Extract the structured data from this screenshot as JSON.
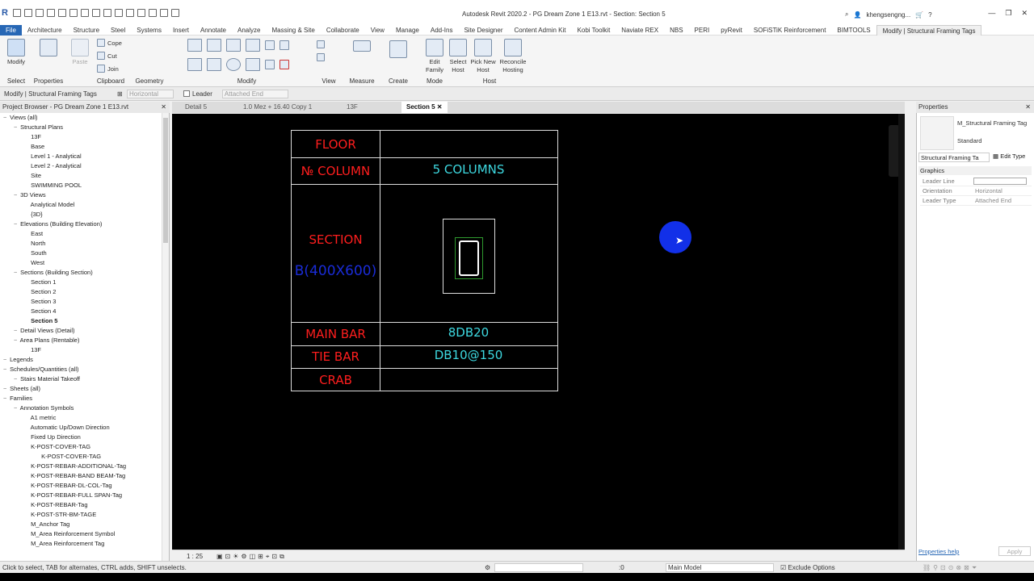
{
  "app": {
    "title": "Autodesk Revit 2020.2 - PG Dream Zone 1 E13.rvt - Section: Section 5",
    "user": "khengsengng...",
    "logo": "R"
  },
  "menu_tabs": [
    "File",
    "Architecture",
    "Structure",
    "Steel",
    "Systems",
    "Insert",
    "Annotate",
    "Analyze",
    "Massing & Site",
    "Collaborate",
    "View",
    "Manage",
    "Add-Ins",
    "Site Designer",
    "Content Admin Kit",
    "Kobi Toolkit",
    "Naviate REX",
    "NBS",
    "PERI",
    "pyRevit",
    "SOFiSTiK Reinforcement",
    "BIMTOOLS",
    "Modify | Structural Framing Tags"
  ],
  "ribbon": {
    "select": {
      "label": "Select",
      "modify": "Modify"
    },
    "properties": {
      "label": "Properties"
    },
    "clipboard": {
      "label": "Clipboard",
      "paste": "Paste",
      "cope": "Cope",
      "cut": "Cut",
      "join": "Join"
    },
    "geometry": {
      "label": "Geometry"
    },
    "modify": {
      "label": "Modify"
    },
    "view": {
      "label": "View"
    },
    "measure": {
      "label": "Measure"
    },
    "create": {
      "label": "Create"
    },
    "mode": {
      "label": "Mode",
      "edit_family": "Edit Family"
    },
    "host": {
      "label": "Host",
      "select_host": "Select Host",
      "pick_new_host": "Pick New Host",
      "reconcile_hosting": "Reconcile Hosting"
    }
  },
  "options_bar": {
    "context": "Modify | Structural Framing Tags",
    "orientation": "Horizontal",
    "leader": "Leader",
    "attached_end": "Attached End"
  },
  "project_browser": {
    "title": "Project Browser - PG Dream Zone 1 E13.rvt",
    "items": [
      {
        "label": "Views (all)",
        "level": 0
      },
      {
        "label": "Structural Plans",
        "level": 1
      },
      {
        "label": "13F",
        "level": 2
      },
      {
        "label": "Base",
        "level": 2
      },
      {
        "label": "Level 1 - Analytical",
        "level": 2
      },
      {
        "label": "Level 2 - Analytical",
        "level": 2
      },
      {
        "label": "Site",
        "level": 2
      },
      {
        "label": "SWIMMING POOL",
        "level": 2
      },
      {
        "label": "3D Views",
        "level": 1
      },
      {
        "label": "Analytical Model",
        "level": 2
      },
      {
        "label": "{3D}",
        "level": 2
      },
      {
        "label": "Elevations (Building Elevation)",
        "level": 1
      },
      {
        "label": "East",
        "level": 2
      },
      {
        "label": "North",
        "level": 2
      },
      {
        "label": "South",
        "level": 2
      },
      {
        "label": "West",
        "level": 2
      },
      {
        "label": "Sections (Building Section)",
        "level": 1
      },
      {
        "label": "Section 1",
        "level": 2
      },
      {
        "label": "Section 2",
        "level": 2
      },
      {
        "label": "Section 3",
        "level": 2
      },
      {
        "label": "Section 4",
        "level": 2
      },
      {
        "label": "Section 5",
        "level": 2,
        "bold": true
      },
      {
        "label": "Detail Views (Detail)",
        "level": 1
      },
      {
        "label": "Area Plans (Rentable)",
        "level": 1
      },
      {
        "label": "13F",
        "level": 2
      },
      {
        "label": "Legends",
        "level": 0
      },
      {
        "label": "Schedules/Quantities (all)",
        "level": 0
      },
      {
        "label": "Stairs Material Takeoff",
        "level": 1
      },
      {
        "label": "Sheets (all)",
        "level": 0
      },
      {
        "label": "Families",
        "level": 0
      },
      {
        "label": "Annotation Symbols",
        "level": 1
      },
      {
        "label": "A1 metric",
        "level": 2
      },
      {
        "label": "Automatic Up/Down Direction",
        "level": 2
      },
      {
        "label": "Fixed Up Direction",
        "level": 2
      },
      {
        "label": "K-POST-COVER-TAG",
        "level": 2
      },
      {
        "label": "K-POST-COVER-TAG",
        "level": 3
      },
      {
        "label": "K-POST-REBAR-ADDITIONAL-Tag",
        "level": 2
      },
      {
        "label": "K-POST-REBAR-BAND BEAM-Tag",
        "level": 2
      },
      {
        "label": "K-POST-REBAR-DL-COL-Tag",
        "level": 2
      },
      {
        "label": "K-POST-REBAR-FULL SPAN-Tag",
        "level": 2
      },
      {
        "label": "K-POST-REBAR-Tag",
        "level": 2
      },
      {
        "label": "K-POST-STR-BM-TAGE",
        "level": 2
      },
      {
        "label": "M_Anchor Tag",
        "level": 2
      },
      {
        "label": "M_Area Reinforcement Symbol",
        "level": 2
      },
      {
        "label": "M_Area Reinforcement Tag",
        "level": 2
      }
    ]
  },
  "view_tabs": [
    {
      "label": "Detail 5"
    },
    {
      "label": "1.0 Mez + 16.40 Copy 1"
    },
    {
      "label": "13F"
    },
    {
      "label": "Section 5",
      "active": true
    }
  ],
  "schedule": {
    "rows": [
      {
        "label": "FLOOR",
        "value": ""
      },
      {
        "label": "№ COLUMN",
        "value": "5 COLUMNS"
      },
      {
        "label": "SECTION",
        "value": "",
        "sublabel": "B(400X600)"
      },
      {
        "label": "MAIN BAR",
        "value": "8DB20"
      },
      {
        "label": "TIE BAR",
        "value": "DB10@150"
      },
      {
        "label": "CRAB",
        "value": ""
      }
    ]
  },
  "properties": {
    "title": "Properties",
    "family": "M_Structural Framing Tag",
    "type": "Standard",
    "selector": "Structural Framing Ta",
    "edit_type": "Edit Type",
    "section": "Graphics",
    "rows": [
      {
        "k": "Leader Line",
        "v": ""
      },
      {
        "k": "Orientation",
        "v": "Horizontal"
      },
      {
        "k": "Leader Type",
        "v": "Attached End"
      }
    ],
    "help": "Properties help",
    "apply": "Apply"
  },
  "view_bar": {
    "scale": "1 : 25"
  },
  "status": {
    "text": "Click to select, TAB for alternates, CTRL adds, SHIFT unselects.",
    "coords": ":0",
    "model": "Main Model",
    "exclude": "Exclude Options"
  },
  "colors": {
    "red_text": "#ff1e1e",
    "cyan_text": "#3dd8e0",
    "blue_text": "#1a2cd8",
    "file_tab": "#2767b5",
    "canvas_bg": "#000000"
  }
}
